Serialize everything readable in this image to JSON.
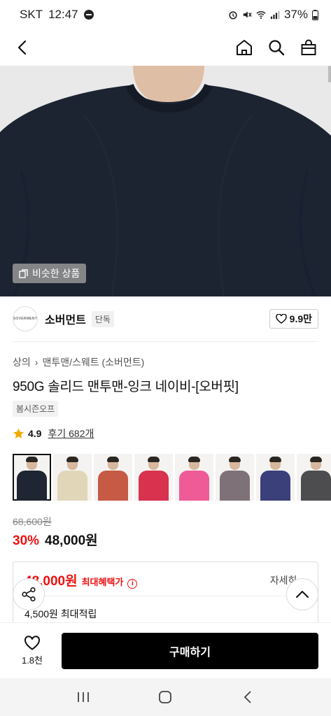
{
  "status_bar": {
    "carrier": "SKT",
    "time": "12:47",
    "battery": "37%"
  },
  "nav": {
    "back_icon": "chevron-left-icon",
    "home_icon": "home-icon",
    "search_icon": "search-icon",
    "cart_icon": "bag-icon"
  },
  "hero": {
    "similar_label": "비슷한 상품",
    "colors": {
      "shirt": "#1c2432",
      "skin": "#e0c0a8",
      "background": "#e9e9ea"
    }
  },
  "brand": {
    "logo_text": "SOVERMENT",
    "name": "소버먼트",
    "badge": "단독",
    "likes": "9.9만"
  },
  "breadcrumb": {
    "level1": "상의",
    "separator": "›",
    "level2": "맨투맨/스웨트 (소버먼트)"
  },
  "product": {
    "title": "950G 솔리드 맨투맨-잉크 네이비-[오버핏]",
    "tag": "봄시즌오프",
    "rating": "4.9",
    "review_text": "후기 682개"
  },
  "color_thumbs": [
    {
      "name": "navy",
      "color": "#1e2533",
      "selected": true
    },
    {
      "name": "beige",
      "color": "#e2d6b8",
      "selected": false
    },
    {
      "name": "brick",
      "color": "#c65a45",
      "selected": false
    },
    {
      "name": "raspberry",
      "color": "#d8324e",
      "selected": false
    },
    {
      "name": "pink",
      "color": "#ef5b97",
      "selected": false
    },
    {
      "name": "mauve-grey",
      "color": "#7e7177",
      "selected": false
    },
    {
      "name": "royal-navy",
      "color": "#3b3f7a",
      "selected": false
    },
    {
      "name": "charcoal",
      "color": "#4d4d50",
      "selected": false
    }
  ],
  "price": {
    "original": "68,600원",
    "discount": "30%",
    "sale": "48,000원"
  },
  "benefit": {
    "max_price": "48,000원",
    "label": "최대혜택가",
    "detail_link": "자세히",
    "points": "4,500원 최대적립"
  },
  "bottom_bar": {
    "wish_count": "1.8천",
    "buy_label": "구매하기"
  },
  "system_nav": {
    "recent_icon": "recent-apps-icon",
    "home_icon": "home-circle-icon",
    "back_icon": "back-icon"
  }
}
